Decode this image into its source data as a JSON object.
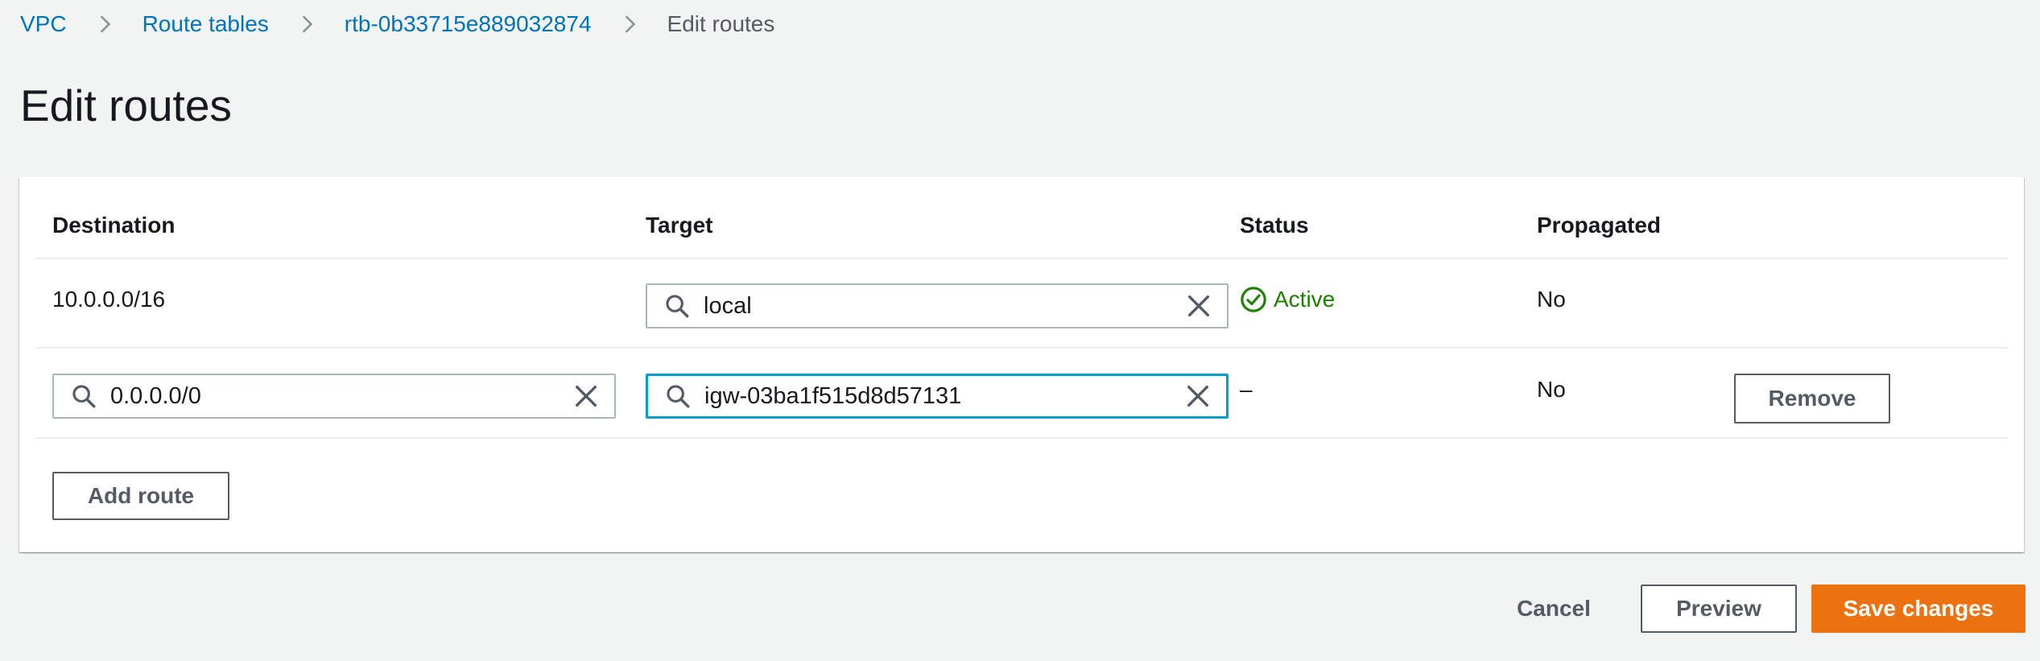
{
  "breadcrumb": {
    "items": [
      "VPC",
      "Route tables",
      "rtb-0b33715e889032874"
    ],
    "current": "Edit routes"
  },
  "page": {
    "title": "Edit routes"
  },
  "table": {
    "headers": {
      "destination": "Destination",
      "target": "Target",
      "status": "Status",
      "propagated": "Propagated"
    },
    "rows": [
      {
        "destination": "10.0.0.0/16",
        "target": "local",
        "status": "Active",
        "propagated": "No"
      },
      {
        "destination": "0.0.0.0/0",
        "target": "igw-03ba1f515d8d57131",
        "status": "–",
        "propagated": "No",
        "remove_label": "Remove"
      }
    ]
  },
  "actions": {
    "add_route": "Add route",
    "cancel": "Cancel",
    "preview": "Preview",
    "save": "Save changes"
  },
  "colors": {
    "link": "#0073bb",
    "active_status": "#1d8102",
    "primary_button": "#ec7211",
    "focus_border": "#00a1c9",
    "background": "#f2f3f3"
  },
  "icons": {
    "breadcrumb_separator": "chevron-right-icon",
    "search": "search-icon",
    "clear": "close-icon",
    "status_active": "check-circle-icon"
  }
}
